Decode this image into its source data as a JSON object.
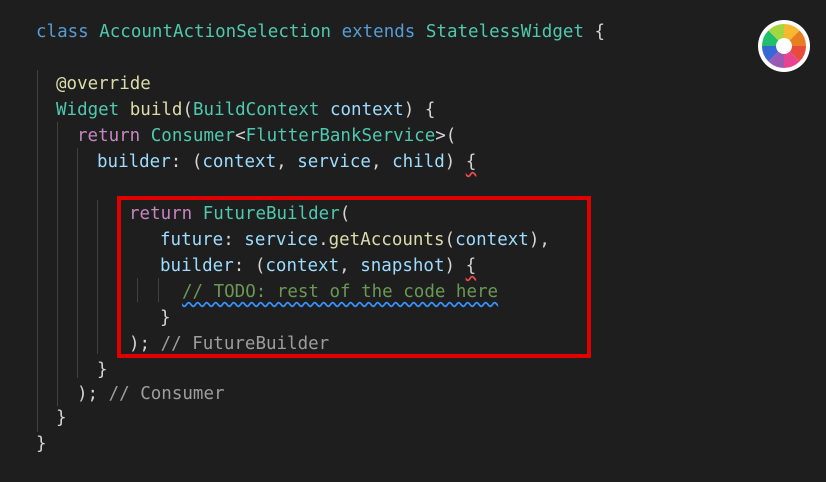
{
  "code": {
    "l1": {
      "class_kw": "class",
      "name": "AccountActionSelection",
      "extends_kw": "extends",
      "base": "StatelessWidget",
      "brace": "{"
    },
    "l3": {
      "annotation": "@override"
    },
    "l4": {
      "type": "Widget",
      "fn": "build",
      "param_type": "BuildContext",
      "param": "context",
      "tail": ") {"
    },
    "l5": {
      "ret": "return",
      "type": "Consumer",
      "generic": "FlutterBankService",
      "tail": ">("
    },
    "l6": {
      "prop": "builder",
      "p1": "context",
      "p2": "service",
      "p3": "child",
      "brace": "{"
    },
    "l8": {
      "ret": "return",
      "type": "FutureBuilder",
      "tail": "("
    },
    "l9": {
      "prop": "future",
      "obj": "service",
      "fn": "getAccounts",
      "arg": "context",
      "tail": "),"
    },
    "l10": {
      "prop": "builder",
      "p1": "context",
      "p2": "snapshot",
      "brace": "{"
    },
    "l11": {
      "comment": "// TODO: rest of the code here"
    },
    "l12": {
      "brace": "}"
    },
    "l13": {
      "tail": ");",
      "hint": "// FutureBuilder"
    },
    "l14": {
      "brace": "}"
    },
    "l15": {
      "tail": ");",
      "hint": "// Consumer"
    },
    "l16": {
      "brace": "}"
    },
    "l17": {
      "brace": "}"
    }
  },
  "icon": {
    "name": "color-wheel-icon"
  }
}
